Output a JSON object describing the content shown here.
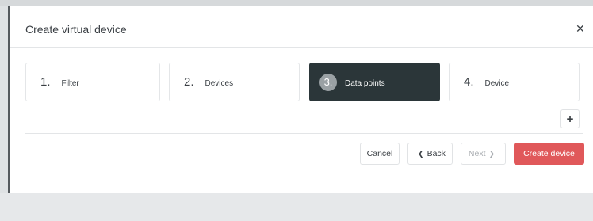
{
  "dialog": {
    "title": "Create virtual device",
    "close_icon": "close-icon"
  },
  "steps": [
    {
      "number": "1.",
      "label": "Filter",
      "active": false
    },
    {
      "number": "2.",
      "label": "Devices",
      "active": false
    },
    {
      "number": "3.",
      "label": "Data points",
      "active": true
    },
    {
      "number": "4.",
      "label": "Device",
      "active": false
    }
  ],
  "actions": {
    "add_icon": "plus-icon",
    "cancel_label": "Cancel",
    "back_label": "Back",
    "next_label": "Next",
    "create_label": "Create device"
  },
  "colors": {
    "active_step": "#2b3639",
    "primary": "#e0585a"
  }
}
